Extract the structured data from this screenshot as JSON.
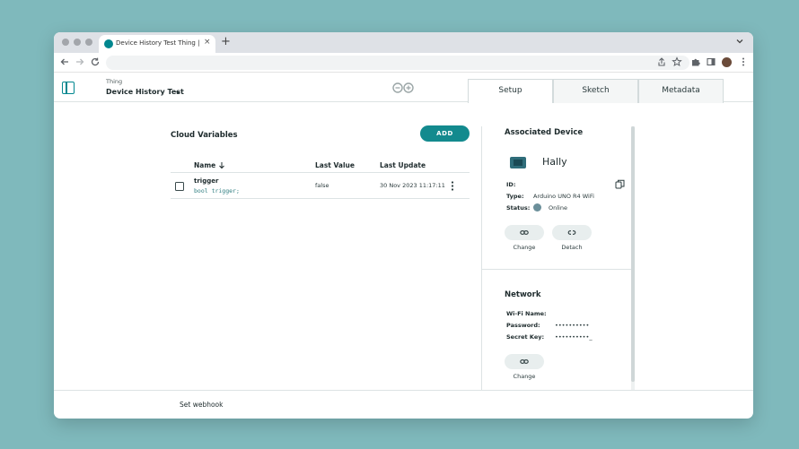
{
  "browser": {
    "tab_title": "Device History Test Thing | Ar",
    "close_glyph": "×",
    "new_tab_glyph": "+"
  },
  "header": {
    "thing_label": "Thing",
    "thing_name": "Device History Test",
    "tabs": [
      "Setup",
      "Sketch",
      "Metadata"
    ],
    "active_tab": "Setup"
  },
  "cloud_variables": {
    "title": "Cloud Variables",
    "add_label": "ADD",
    "columns": {
      "name": "Name",
      "last_value": "Last Value",
      "last_update": "Last Update"
    },
    "rows": [
      {
        "name": "trigger",
        "declaration": "bool trigger;",
        "last_value": "false",
        "last_update": "30 Nov 2023 11:17:11"
      }
    ]
  },
  "device": {
    "title": "Associated Device",
    "name": "Hally",
    "id_label": "ID:",
    "id_value": "",
    "type_label": "Type:",
    "type_value": "Arduino UNO R4 WiFi",
    "status_label": "Status:",
    "status_value": "Online",
    "change_label": "Change",
    "detach_label": "Detach"
  },
  "network": {
    "title": "Network",
    "wifi_label": "Wi-Fi Name:",
    "wifi_value": "",
    "password_label": "Password:",
    "password_value": "••••••••••",
    "secret_label": "Secret Key:",
    "secret_value": "••••••••••_",
    "change_label": "Change"
  },
  "footer": {
    "webhook_label": "Set webhook"
  },
  "colors": {
    "accent": "#138a8e",
    "background": "#7fb9bc",
    "status_online": "#6b8f9a"
  }
}
